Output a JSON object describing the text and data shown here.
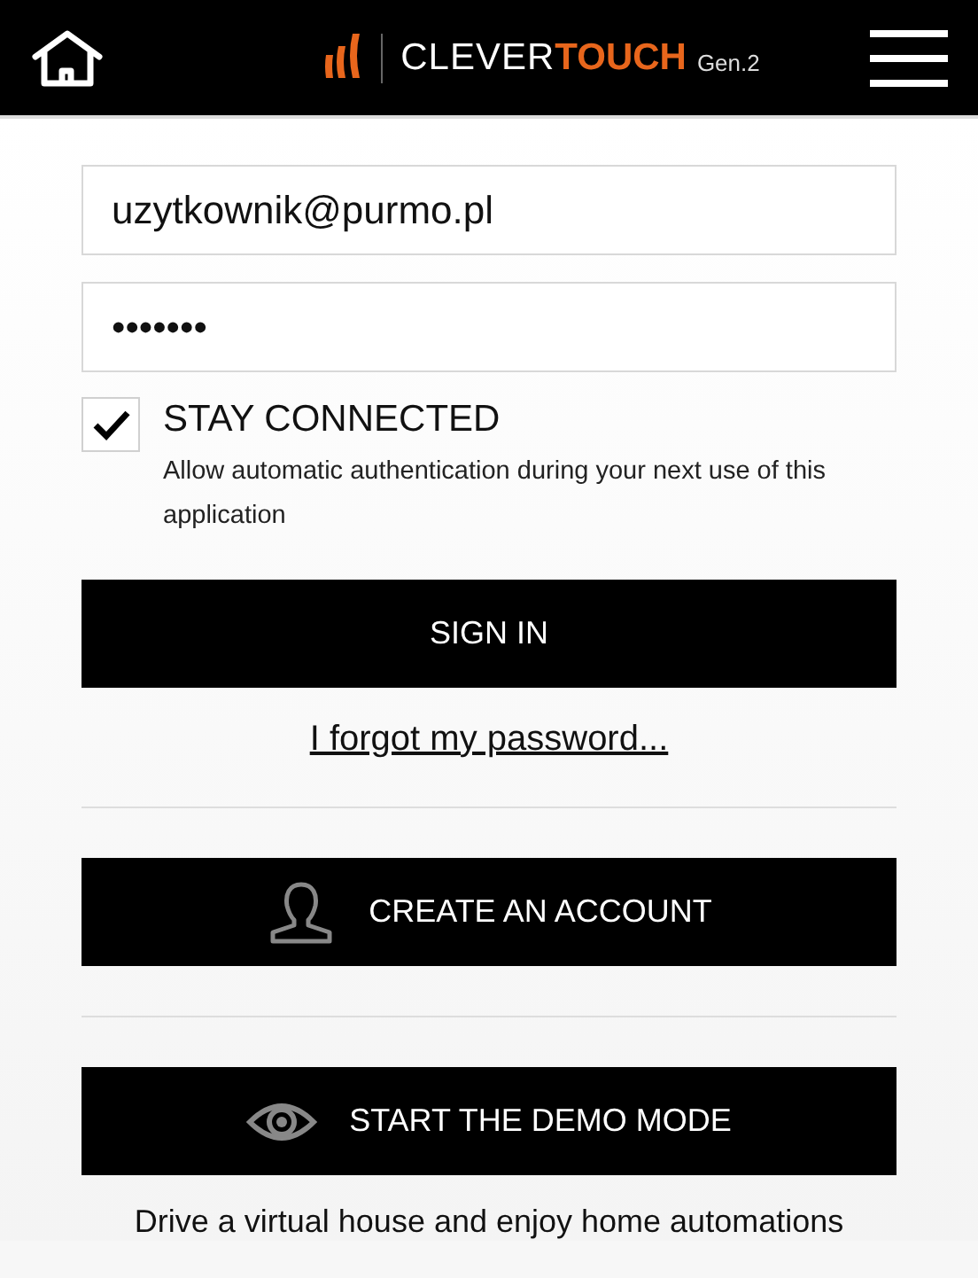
{
  "header": {
    "logo": {
      "light": "CLEVER",
      "bold": "TOUCH",
      "suffix": "Gen.2"
    }
  },
  "email_field": {
    "value": "uzytkownik@purmo.pl"
  },
  "password_field": {
    "value": "•••••••"
  },
  "stay_connected": {
    "label": "STAY CONNECTED",
    "checked": true,
    "description": "Allow automatic authentication during your next use of this application"
  },
  "sign_in_button": "SIGN IN",
  "forgot_link": "I forgot my password...",
  "actions": [
    {
      "kind": "account",
      "label": "CREATE AN ACCOUNT"
    },
    {
      "kind": "demo",
      "label": "START THE DEMO MODE"
    }
  ],
  "demo_note": "Drive a virtual house and enjoy home automations"
}
